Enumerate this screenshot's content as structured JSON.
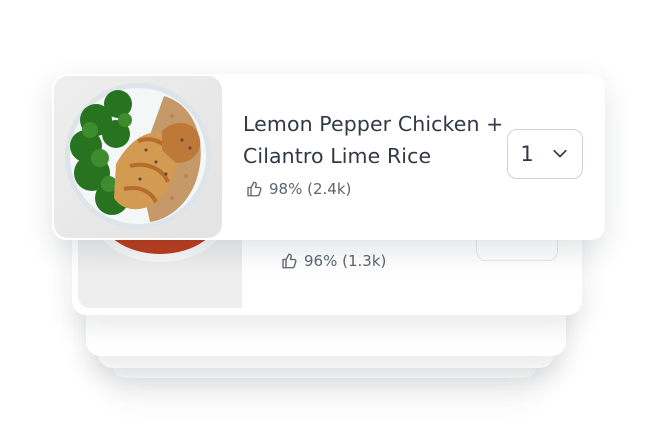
{
  "meals": [
    {
      "name": "Lemon Pepper Chicken + Cilantro Lime Rice",
      "rating": "98% (2.4k)",
      "quantity": "1",
      "icon": "thumbs-up-icon"
    },
    {
      "rating": "96% (1.3k)",
      "icon": "thumbs-up-icon"
    }
  ],
  "colors": {
    "text": "#303944",
    "muted": "#5d6570",
    "border": "#ccd2d8"
  }
}
